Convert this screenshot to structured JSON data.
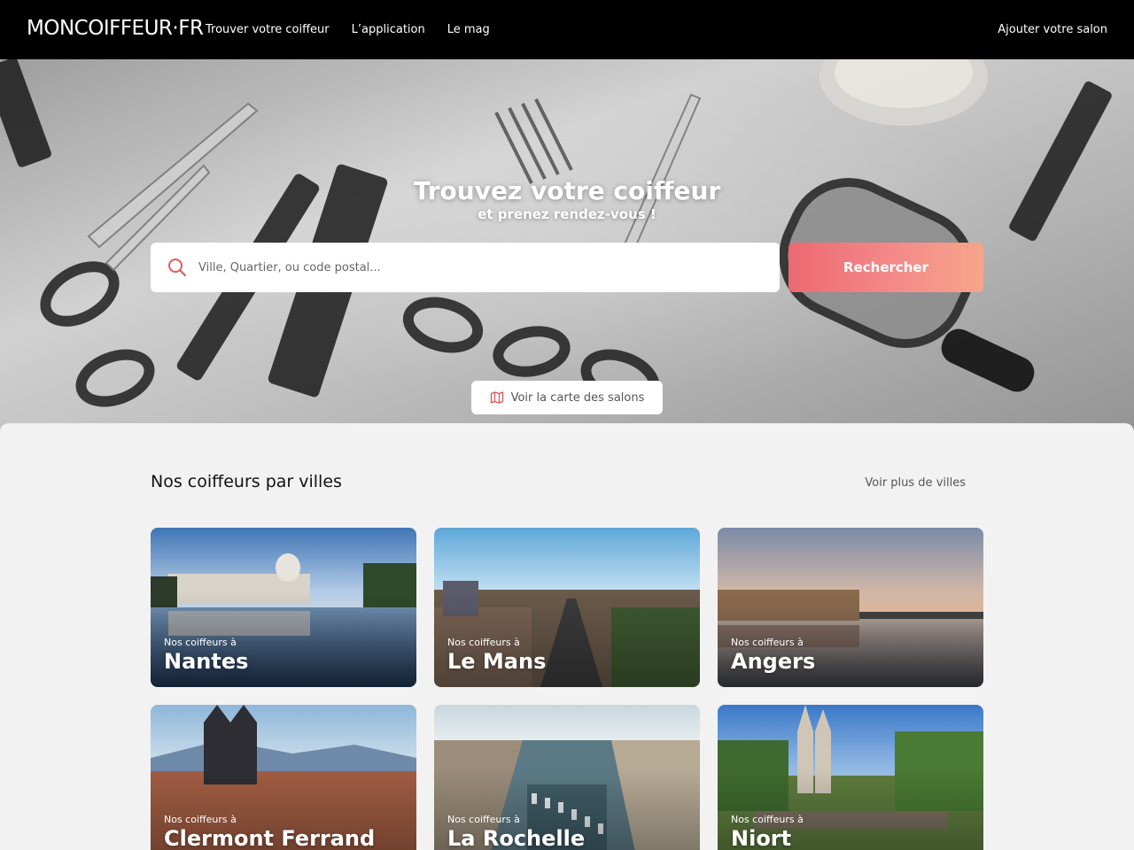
{
  "header": {
    "logo_text": "MONCOIFFEUR·FR",
    "nav": [
      {
        "label": "Trouver votre coiffeur"
      },
      {
        "label": "L’application"
      },
      {
        "label": "Le mag"
      }
    ],
    "right_link": "Ajouter votre salon"
  },
  "hero": {
    "title": "Trouvez votre coiffeur",
    "subtitle": "et prenez rendez-vous !",
    "search_placeholder": "Ville, Quartier, ou code postal...",
    "search_button": "Rechercher",
    "map_button": "Voir la carte des salons"
  },
  "cities_section": {
    "title": "Nos coiffeurs par villes",
    "more_link": "Voir plus de villes",
    "cards": [
      {
        "prefix": "Nos coiffeurs à",
        "city": "Nantes"
      },
      {
        "prefix": "Nos coiffeurs à",
        "city": "Le Mans"
      },
      {
        "prefix": "Nos coiffeurs à",
        "city": "Angers"
      },
      {
        "prefix": "Nos coiffeurs à",
        "city": "Clermont Ferrand"
      },
      {
        "prefix": "Nos coiffeurs à",
        "city": "La Rochelle"
      },
      {
        "prefix": "Nos coiffeurs à",
        "city": "Niort"
      }
    ]
  },
  "colors": {
    "topbar": "#000000",
    "accent_start": "#ec6a72",
    "accent_end": "#f6a58a",
    "page_bg": "#f2f2f2"
  },
  "icons": [
    "search-icon",
    "map-icon"
  ]
}
